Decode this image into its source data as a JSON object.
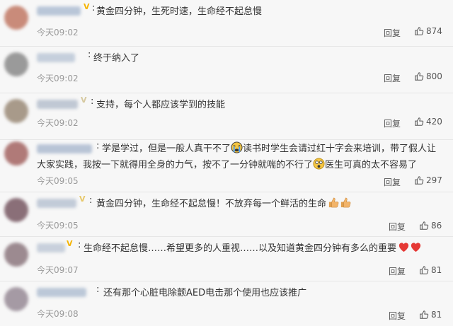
{
  "colors": {
    "background": "#f7f7f7",
    "text": "#333333",
    "time": "#9a9a9a",
    "vip_badge": "#f5b400",
    "heart": "#e53935",
    "thumbs_emoji": "#f2b46a"
  },
  "comments": [
    {
      "text": "黄金四分钟，生死时速，生命经不起怠慢",
      "time": "今天09:02",
      "reply": "回复",
      "likes": "874"
    },
    {
      "text": "终于纳入了",
      "time": "今天09:02",
      "reply": "回复",
      "likes": "800"
    },
    {
      "text": "支持，每个人都应该学到的技能",
      "time": "今天09:02",
      "reply": "回复",
      "likes": "420"
    },
    {
      "text_part1": "学是学过，但是一般人真干不了",
      "text_part2": "读书时学生会请过红十字会来培训，带了假人让大家实践，我按一下就得用全身的力气，按不了一分钟就喘的不行了",
      "text_part3": "医生可真的太不容易了",
      "time": "今天09:05",
      "reply": "回复",
      "likes": "297"
    },
    {
      "text": "黄金四分钟，生命经不起怠慢！不放弃每一个鲜活的生命",
      "time": "今天09:05",
      "reply": "回复",
      "likes": "86"
    },
    {
      "text": "生命经不起怠慢……希望更多的人重视……以及知道黄金四分钟有多么的重要",
      "time": "今天09:07",
      "reply": "回复",
      "likes": "81"
    },
    {
      "text": "还有那个心脏电除颤AED电击那个使用也应该推广",
      "time": "今天09:08",
      "reply": "回复",
      "likes": "81"
    }
  ],
  "icons": {
    "like": "thumbs-up-outline-icon",
    "vip": "vip-badge-icon",
    "sob_emoji": "sobbing-face-emoji",
    "dizzy_emoji": "dizzy-face-emoji",
    "thumbs_emoji": "thumbs-up-emoji",
    "heart_emoji": "red-heart-emoji"
  }
}
